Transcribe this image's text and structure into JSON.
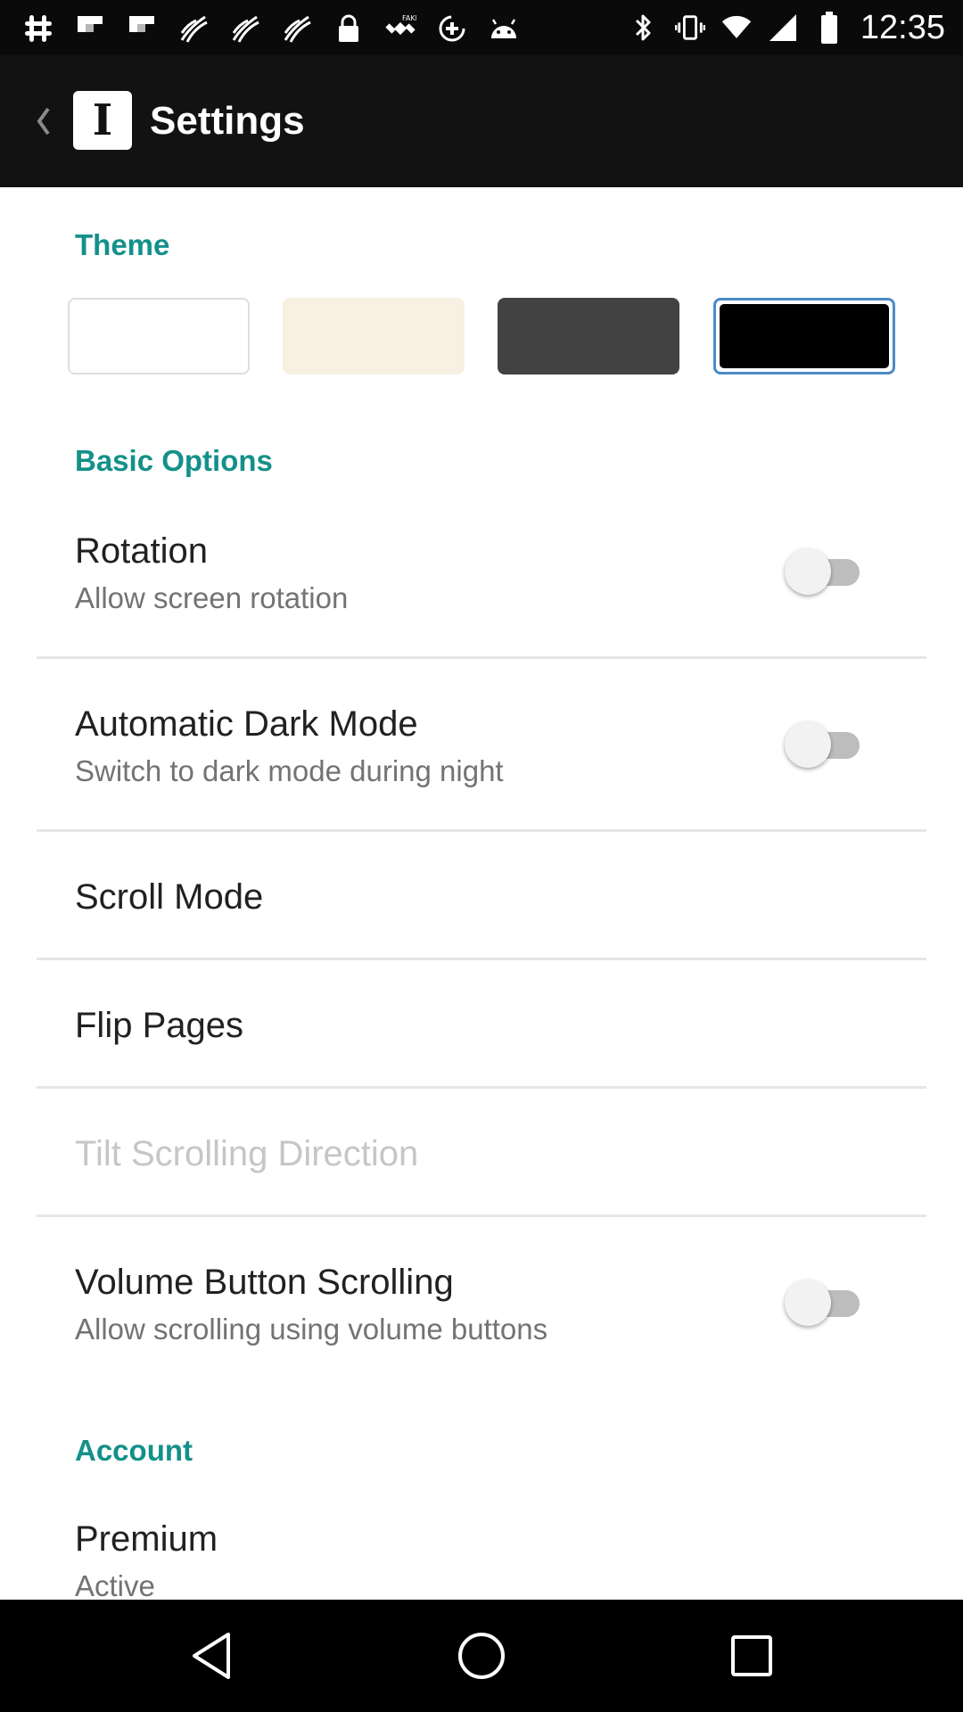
{
  "status_bar": {
    "time": "12:35",
    "left_icons": [
      "slack-icon",
      "flipboard-icon",
      "flipboard-icon",
      "rss-feed-icon",
      "rss-feed-icon",
      "rss-feed-icon",
      "lock-icon",
      "fake-gps-icon",
      "data-saver-icon",
      "android-icon"
    ],
    "right_icons": [
      "bluetooth-icon",
      "vibrate-icon",
      "wifi-icon",
      "signal-icon",
      "battery-icon"
    ]
  },
  "toolbar": {
    "title": "Settings",
    "logo_letter": "I"
  },
  "theme": {
    "header": "Theme",
    "swatches": [
      {
        "name": "white",
        "color": "#ffffff"
      },
      {
        "name": "sepia",
        "color": "#f8f0e3"
      },
      {
        "name": "dark",
        "color": "#424242"
      },
      {
        "name": "black",
        "color": "#000000",
        "selected": true
      }
    ]
  },
  "basic_options": {
    "header": "Basic Options",
    "items": [
      {
        "title": "Rotation",
        "subtitle": "Allow screen rotation",
        "toggle": false
      },
      {
        "title": "Automatic Dark Mode",
        "subtitle": "Switch to dark mode during night",
        "toggle": false
      },
      {
        "title": "Scroll Mode"
      },
      {
        "title": "Flip Pages"
      },
      {
        "title": "Tilt Scrolling Direction",
        "disabled": true
      },
      {
        "title": "Volume Button Scrolling",
        "subtitle": "Allow scrolling using volume buttons",
        "toggle": false
      }
    ]
  },
  "account": {
    "header": "Account",
    "items": [
      {
        "title": "Premium",
        "subtitle": "Active"
      }
    ]
  },
  "nav_bar": {
    "buttons": [
      "back-triangle-icon",
      "home-circle-icon",
      "recents-square-icon"
    ]
  },
  "colors": {
    "accent": "#14908a",
    "toolbar": "#121212",
    "selected_outline": "#4c8cc4"
  }
}
